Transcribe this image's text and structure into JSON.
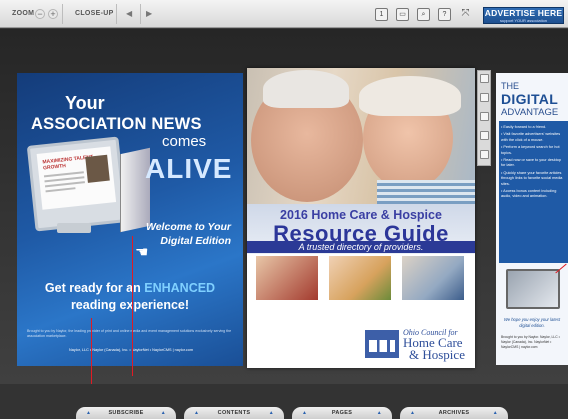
{
  "toolbar": {
    "zoom_label": "ZOOM",
    "zoom_out": "−",
    "zoom_in": "+",
    "closeup_label": "CLOSE-UP",
    "prev_glyph": "◀",
    "next_glyph": "▶",
    "icons": [
      {
        "name": "single-page-icon",
        "glyph": "1"
      },
      {
        "name": "thumbnail-icon",
        "glyph": "▭"
      },
      {
        "name": "search-icon",
        "glyph": "⌕"
      },
      {
        "name": "help-icon",
        "glyph": "?"
      },
      {
        "name": "fullscreen-icon",
        "glyph": "⤧"
      }
    ],
    "advertise": {
      "line1": "ADVERTISE HERE",
      "line2": "support YOUR association"
    }
  },
  "left_page": {
    "your": "Your",
    "association_news": "ASSOCIATION NEWS",
    "comes": "comes",
    "alive": "ALIVE",
    "welcome": "Welcome to Your",
    "digital_edition": "Digital Edition",
    "ready_prefix": "Get ready for an ",
    "ready_em": "ENHANCED",
    "ready_line2": "reading experience!",
    "monitor_headline": "MAXIMIZING TALENT GROWTH",
    "footer": "Brought to you by Naylor, the leading provider of print and online media and event management solutions exclusively serving the association marketplace.",
    "links": "Naylor, LLC • Naylor (Canada), Inc. • NaylorNet • NaylorCMS | naylor.com"
  },
  "center_page": {
    "year_line": "2016 Home Care & Hospice",
    "title": "Resource Guide",
    "tagline": "A trusted directory of providers.",
    "logo_line1": "Ohio Council for",
    "logo_line2": "Home Care",
    "logo_line3": "& Hospice"
  },
  "right_page": {
    "the": "THE",
    "digital": "DIGITAL",
    "advantage": "ADVANTAGE",
    "bullets": [
      "• Easily forward to a friend.",
      "• Visit favorite advertisers' websites with the click of a mouse.",
      "• Perform a keyword search for hot topics.",
      "• Read now or save to your desktop for later.",
      "• Quickly share your favorite articles through links to favorite social media sites.",
      "• Access bonus content including audio, video and animation."
    ],
    "hope": "We hope you enjoy your latest digital edition.",
    "credit": "Brought to you by Naylor. Naylor, LLC • Naylor (Canada), Inc. NaylorNet • NaylorCMS | naylor.com"
  },
  "bottom_nav": [
    {
      "name": "nav-subscribe",
      "label": "SUBSCRIBE"
    },
    {
      "name": "nav-contents",
      "label": "CONTENTS"
    },
    {
      "name": "nav-pages",
      "label": "PAGES"
    },
    {
      "name": "nav-archives",
      "label": "ARCHIVES"
    }
  ],
  "colors": {
    "accent": "#1f5aa6",
    "title_blue": "#2c3699",
    "guide_red": "#e01b24"
  }
}
